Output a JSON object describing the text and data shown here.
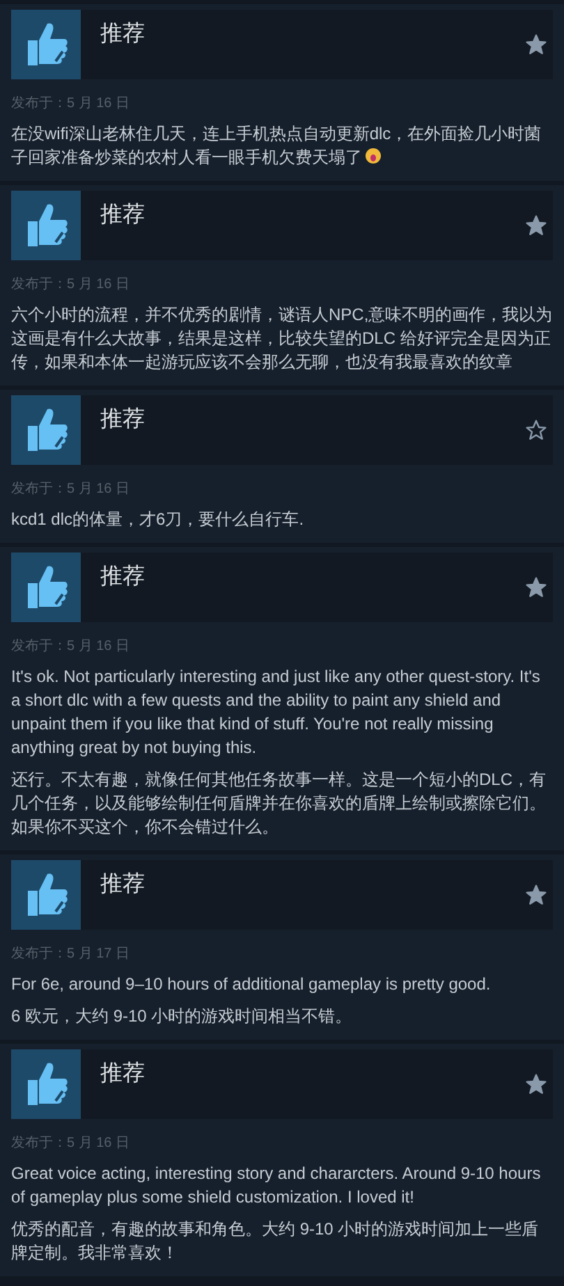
{
  "reviews": [
    {
      "title": "推荐",
      "starred": true,
      "date": "发布于：5 月 16 日",
      "paragraphs": [
        "在没wifi深山老林住几天，连上手机热点自动更新dlc，在外面捡几小时菌子回家准备炒菜的农村人看一眼手机欠费天塌了"
      ],
      "trailing_emoji": true
    },
    {
      "title": "推荐",
      "starred": true,
      "date": "发布于：5 月 16 日",
      "paragraphs": [
        "六个小时的流程，并不优秀的剧情，谜语人NPC,意味不明的画作，我以为这画是有什么大故事，结果是这样，比较失望的DLC 给好评完全是因为正传，如果和本体一起游玩应该不会那么无聊，也没有我最喜欢的纹章"
      ],
      "trailing_emoji": false
    },
    {
      "title": "推荐",
      "starred": false,
      "date": "发布于：5 月 16 日",
      "paragraphs": [
        "kcd1 dlc的体量，才6刀，要什么自行车."
      ],
      "trailing_emoji": false
    },
    {
      "title": "推荐",
      "starred": true,
      "date": "发布于：5 月 16 日",
      "paragraphs": [
        "It's ok. Not particularly interesting and just like any other quest-story. It's a short dlc with a few quests and the ability to paint any shield and unpaint them if you like that kind of stuff. You're not really missing anything great by not buying this.",
        "还行。不太有趣，就像任何其他任务故事一样。这是一个短小的DLC，有几个任务，以及能够绘制任何盾牌并在你喜欢的盾牌上绘制或擦除它们。如果你不买这个，你不会错过什么。"
      ],
      "trailing_emoji": false
    },
    {
      "title": "推荐",
      "starred": true,
      "date": "发布于：5 月 17 日",
      "paragraphs": [
        "For 6e, around 9–10 hours of additional gameplay is pretty good.",
        "6 欧元，大约 9-10 小时的游戏时间相当不错。"
      ],
      "trailing_emoji": false
    },
    {
      "title": "推荐",
      "starred": true,
      "date": "发布于：5 月 16 日",
      "paragraphs": [
        "Great voice acting, interesting story and chararcters. Around 9-10 hours of gameplay plus some shield customization. I loved it!",
        "优秀的配音，有趣的故事和角色。大约 9-10 小时的游戏时间加上一些盾牌定制。我非常喜欢！"
      ],
      "trailing_emoji": false
    }
  ]
}
